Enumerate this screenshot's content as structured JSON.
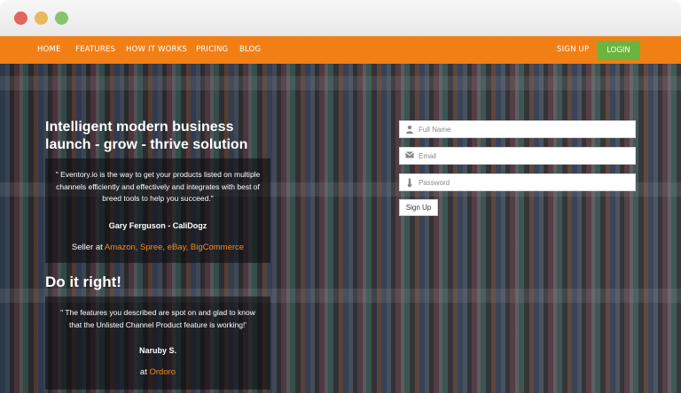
{
  "window": {
    "buttons": [
      "close",
      "minimize",
      "maximize"
    ]
  },
  "nav": {
    "items": [
      "HOME",
      "FEATURES",
      "HOW IT WORKS",
      "PRICING",
      "BLOG"
    ],
    "signup_label": "SIGN UP",
    "login_label": "LOGIN"
  },
  "colors": {
    "nav_bg": "#f27f16",
    "login_bg": "#6bb43f",
    "link_accent": "#f58a1f"
  },
  "hero": {
    "headline_line1": "Intelligent modern business",
    "headline_line2": "launch - grow - thrive solution",
    "testimonial1": {
      "quote": "\" Eventory.io is the way to get your products listed on multiple channels efficiently and effectively and integrates with best of breed tools to help you succeed.\"",
      "author": "Gary Ferguson - CaliDogz",
      "seller_prefix": "Seller at",
      "seller_links": "Amazon, Spree, eBay, BigCommerce"
    },
    "section_title": "Do it right!",
    "testimonial2": {
      "quote": "\" The features you described are spot on and glad to know that the Unlisted Channel Product feature is working!'",
      "author": "Naruby S.",
      "seller_prefix": "at",
      "seller_links": "Ordoro"
    }
  },
  "form": {
    "full_name_placeholder": "Full Name",
    "email_placeholder": "Email",
    "password_placeholder": "Password",
    "submit_label": "Sign Up",
    "icons": [
      "user-icon",
      "envelope-icon",
      "thermometer-icon"
    ]
  }
}
